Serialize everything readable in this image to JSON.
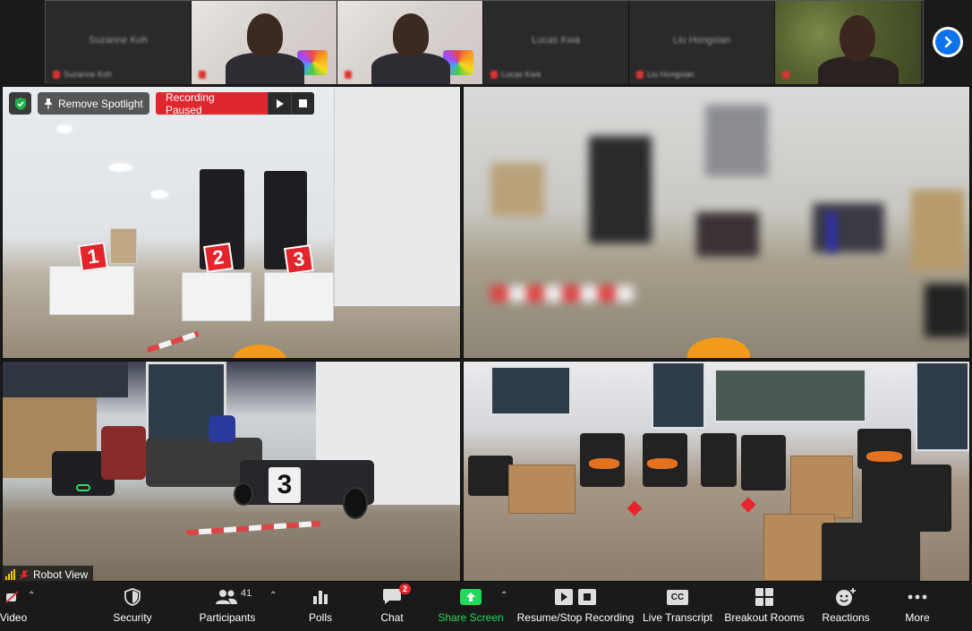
{
  "gallery": {
    "thumbs": [
      {
        "name": "Suzanne Koh",
        "footer": "Suzanne Koh"
      },
      {
        "name": "",
        "footer": ""
      },
      {
        "name": "",
        "footer": ""
      },
      {
        "name": "Lucas Kwa",
        "footer": "Lucas Kwa"
      },
      {
        "name": "Liu Hongxian",
        "footer": "Liu Hongxian"
      },
      {
        "name": "",
        "footer": ""
      }
    ]
  },
  "overlay": {
    "remove_spotlight": "Remove Spotlight",
    "recording_status": "Recording Paused"
  },
  "tiles": {
    "tile1_signs": [
      "1",
      "2",
      "3"
    ],
    "tile3_plate": "3",
    "tile3_name": "Robot View"
  },
  "toolbar": {
    "video": "Video",
    "security": "Security",
    "participants": "Participants",
    "participants_count": "41",
    "polls": "Polls",
    "chat": "Chat",
    "chat_badge": "2",
    "share_screen": "Share Screen",
    "record": "Resume/Stop Recording",
    "transcript": "Live Transcript",
    "transcript_icon": "CC",
    "breakout": "Breakout Rooms",
    "reactions": "Reactions",
    "more": "More"
  },
  "colors": {
    "recording_red": "#e0262e",
    "share_green": "#23d959",
    "accent_blue": "#0e72ed"
  }
}
